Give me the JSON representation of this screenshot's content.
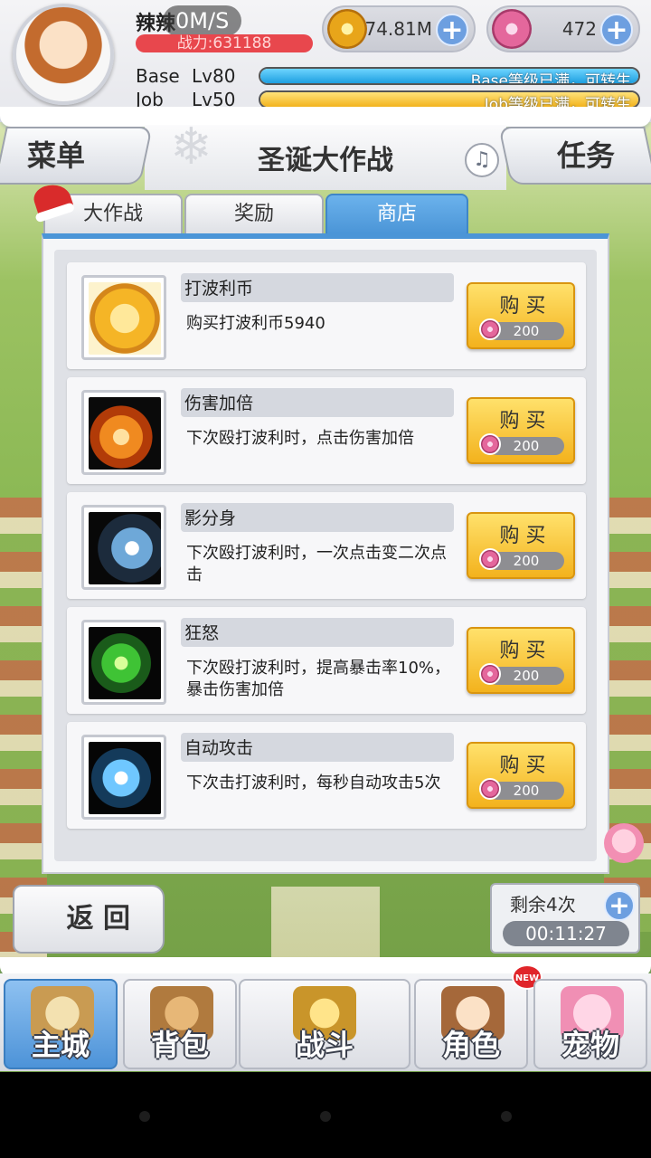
{
  "header": {
    "player_name": "辣辣",
    "net_speed": "0M/S",
    "power": "战力:631188",
    "zeny": "74.81M",
    "gems": "472",
    "base_label": "Base",
    "base_level": "Lv80",
    "base_status": "Base等级已满，可转生",
    "job_label": "Job",
    "job_level": "Lv50",
    "job_status": "Job等级已满，可转生"
  },
  "nav": {
    "menu": "菜单",
    "title": "圣诞大作战",
    "quests": "任务"
  },
  "tabs": [
    {
      "label": "大作战",
      "active": false
    },
    {
      "label": "奖励",
      "active": false
    },
    {
      "label": "商店",
      "active": true
    }
  ],
  "shop": {
    "buy_label": "购 买",
    "items": [
      {
        "name": "打波利币",
        "desc": "购买打波利币5940",
        "price": "200",
        "icon": "fist-coin-icon"
      },
      {
        "name": "伤害加倍",
        "desc": "下次殴打波利时，点击伤害加倍",
        "price": "200",
        "icon": "fire-damage-icon"
      },
      {
        "name": "影分身",
        "desc": "下次殴打波利时，一次点击变二次点击",
        "price": "200",
        "icon": "shadow-clone-icon"
      },
      {
        "name": "狂怒",
        "desc": "下次殴打波利时，提高暴击率10%，暴击伤害加倍",
        "price": "200",
        "icon": "rage-icon"
      },
      {
        "name": "自动攻击",
        "desc": "下次击打波利时，每秒自动攻击5次",
        "price": "200",
        "icon": "auto-attack-icon"
      }
    ]
  },
  "footer": {
    "back": "返 回",
    "remaining": "剩余4次",
    "timer": "00:11:27"
  },
  "tabbar": [
    {
      "label": "主城",
      "active": true
    },
    {
      "label": "背包",
      "active": false
    },
    {
      "label": "战斗",
      "active": false
    },
    {
      "label": "角色",
      "active": false,
      "badge": "NEW"
    },
    {
      "label": "宠物",
      "active": false
    }
  ],
  "colors": {
    "accent_blue": "#4b95d7",
    "buy_yellow": "#f3b21d",
    "power_red": "#e8474d"
  }
}
